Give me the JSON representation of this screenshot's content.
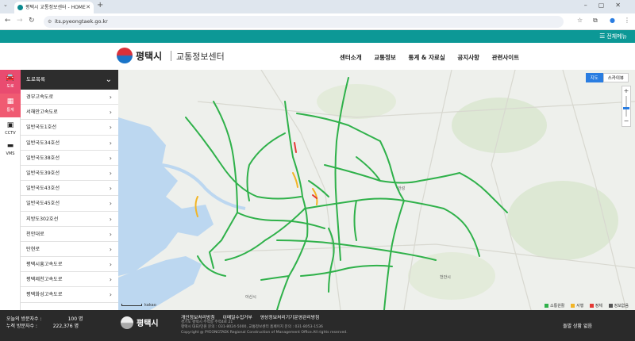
{
  "browser": {
    "tab_title": "평택시 교통정보센터 - HOME",
    "url": "its.pyeongtaek.go.kr"
  },
  "site": {
    "all_menu": "전체메뉴",
    "logo_name": "평택시",
    "logo_sub": "교통정보센터",
    "nav": [
      "센터소개",
      "교통정보",
      "통계 & 자료실",
      "공지사항",
      "관련사이트"
    ]
  },
  "iconbar": {
    "road": "도로",
    "stat": "통계",
    "cctv": "CCTV",
    "vms": "VMS"
  },
  "road_panel": {
    "title": "도로목록",
    "items": [
      "경부고속도로",
      "서해안고속도로",
      "일반국도1호선",
      "일반국도34호선",
      "일반국도38호선",
      "일반국도39호선",
      "일반국도43호선",
      "일반국도45호선",
      "지방도302호선",
      "천안대로",
      "탄현로",
      "평택시흥고속도로",
      "평택제천고속도로",
      "평택화성고속도로"
    ]
  },
  "map": {
    "type_map": "지도",
    "type_sky": "스카이뷰",
    "scale_text": "kakao",
    "legend": [
      {
        "label": "소통원활",
        "color": "#2fb14a"
      },
      {
        "label": "서행",
        "color": "#f2b526"
      },
      {
        "label": "정체",
        "color": "#e53935"
      },
      {
        "label": "정보없음",
        "color": "#555555"
      }
    ],
    "labels": [
      "안성",
      "천안시",
      "아산시"
    ]
  },
  "footer": {
    "visit_today_label": "오늘의 방문자수 :",
    "visit_today_value": "100 명",
    "visit_total_label": "누적 방문자수 :",
    "visit_total_value": "222,376 명",
    "logo_name": "평택시",
    "links": [
      "개인정보처리방침",
      "이메일수집거부",
      "영상정보처리기기운영관리방침"
    ],
    "info_line1": "경기도 평택시 주력동 주력4로 21",
    "info_line2": "평택시 대표/민원 문의 : 031-8024-5000, 교통정보센터 홈페이지 문의 : 031-8053-1536",
    "info_line3": "Copyright @ PYEONGTAEK Regional Construction of Management Office.All rights reserved.",
    "status": "돌발 상황 없음"
  }
}
